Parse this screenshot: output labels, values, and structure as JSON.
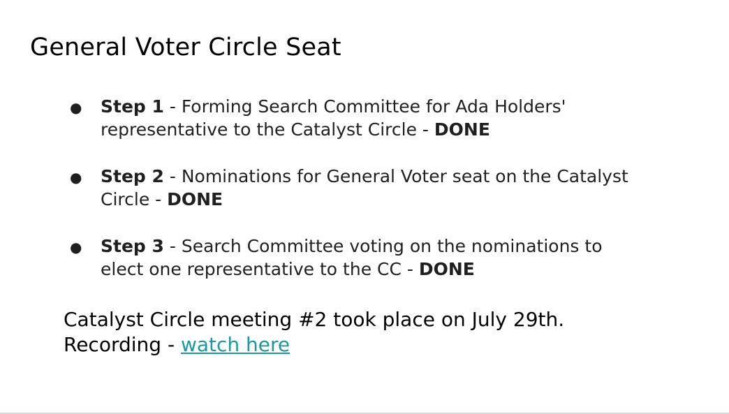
{
  "slide": {
    "title": "General Voter Circle Seat",
    "bullet_glyph": "●",
    "steps": [
      {
        "label": "Step 1",
        "text": " - Forming Search Committee for Ada Holders' representative to the Catalyst Circle - ",
        "status": "DONE"
      },
      {
        "label": "Step 2",
        "text": " - Nominations for General Voter seat on the Catalyst Circle - ",
        "status": "DONE"
      },
      {
        "label": "Step 3",
        "text": " - Search Committee voting on the nominations to elect one representative to the CC - ",
        "status": "DONE"
      }
    ],
    "meeting_note": "Catalyst Circle meeting #2 took place on July 29th.",
    "recording_prefix": "Recording - ",
    "recording_link_label": "watch here",
    "colors": {
      "link": "#1a9aa0",
      "text": "#1f1f1f",
      "title": "#000000"
    }
  }
}
